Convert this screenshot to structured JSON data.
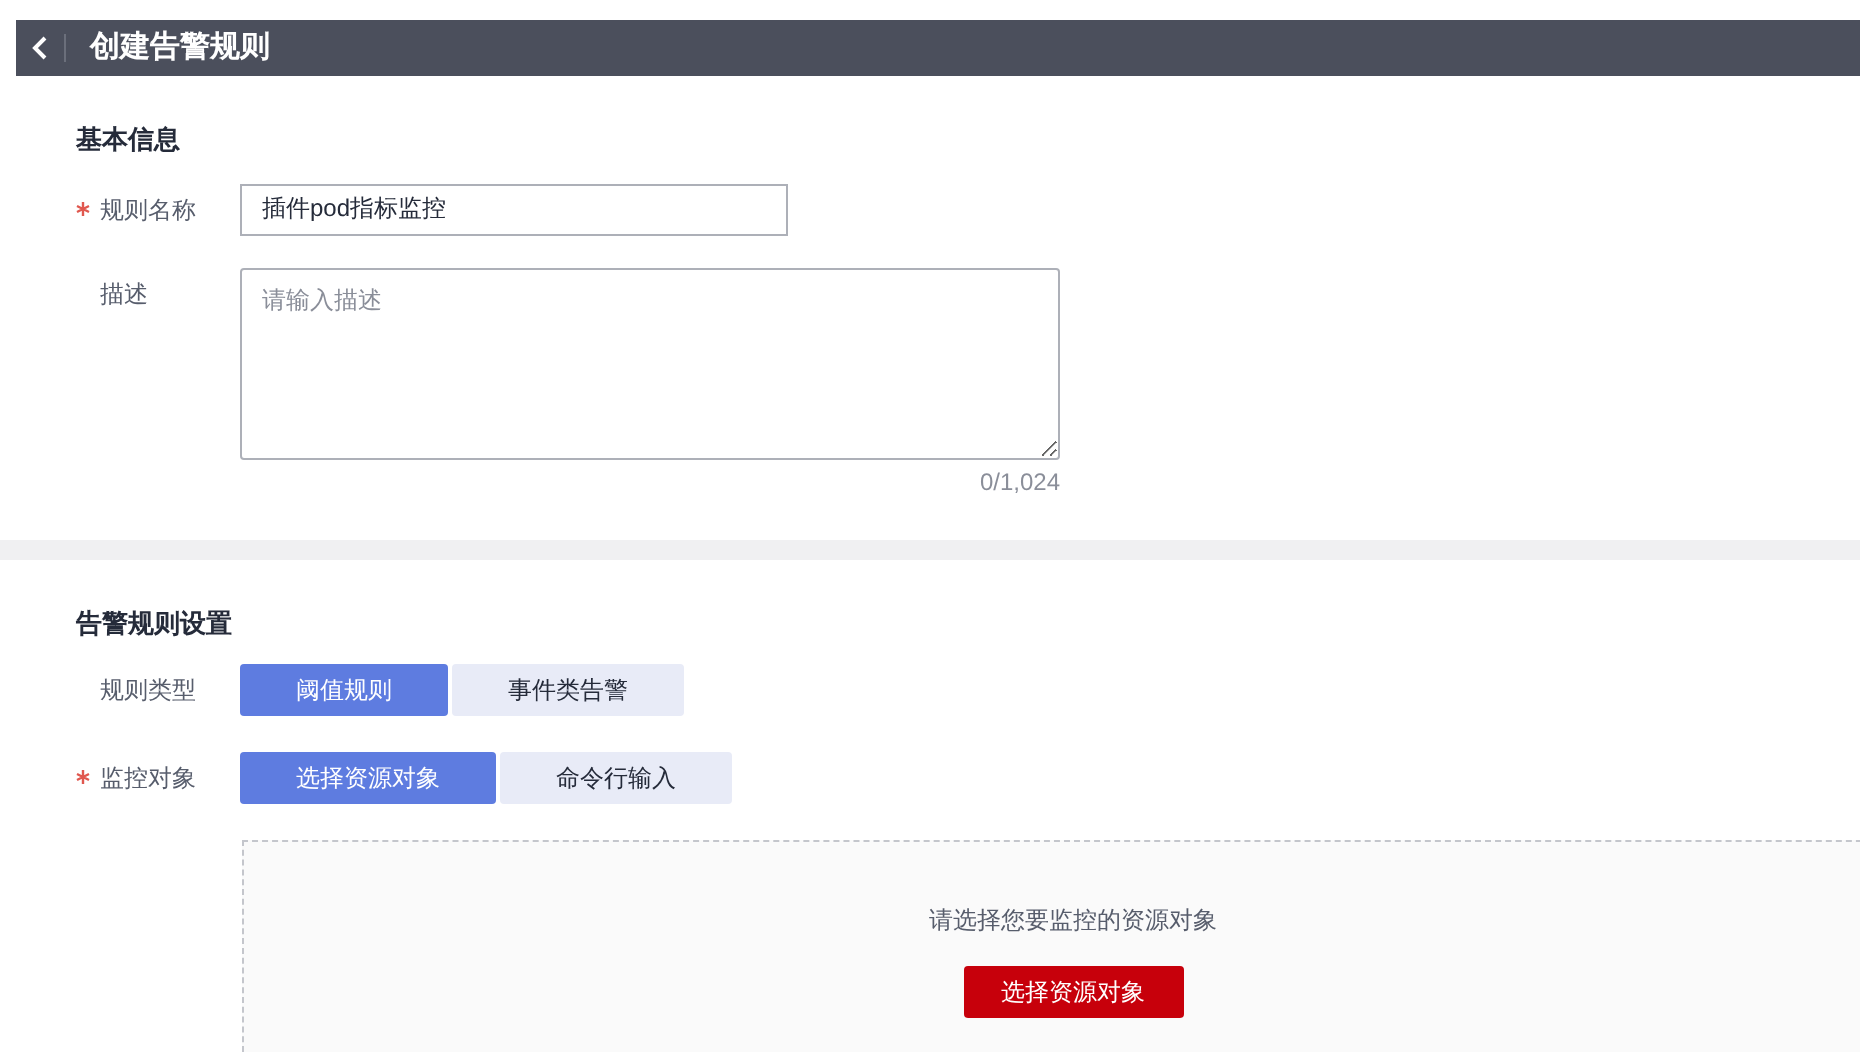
{
  "header": {
    "title": "创建告警规则"
  },
  "basic_info": {
    "heading": "基本信息",
    "fields": [
      {
        "kind": "input",
        "label": "规则名称",
        "required": true,
        "value": "插件pod指标监控"
      },
      {
        "kind": "textarea",
        "label": "描述",
        "required": false,
        "placeholder": "请输入描述",
        "counter": "0/1,024"
      }
    ]
  },
  "rule_settings": {
    "heading": "告警规则设置",
    "rows": [
      {
        "label": "规则类型",
        "required": false,
        "options": [
          {
            "label": "阈值规则",
            "selected": true
          },
          {
            "label": "事件类告警",
            "selected": false
          }
        ]
      },
      {
        "label": "监控对象",
        "required": true,
        "options": [
          {
            "label": "选择资源对象",
            "selected": true
          },
          {
            "label": "命令行输入",
            "selected": false
          }
        ]
      }
    ],
    "resource_panel": {
      "prompt": "请选择您要监控的资源对象",
      "button": "选择资源对象"
    }
  }
}
